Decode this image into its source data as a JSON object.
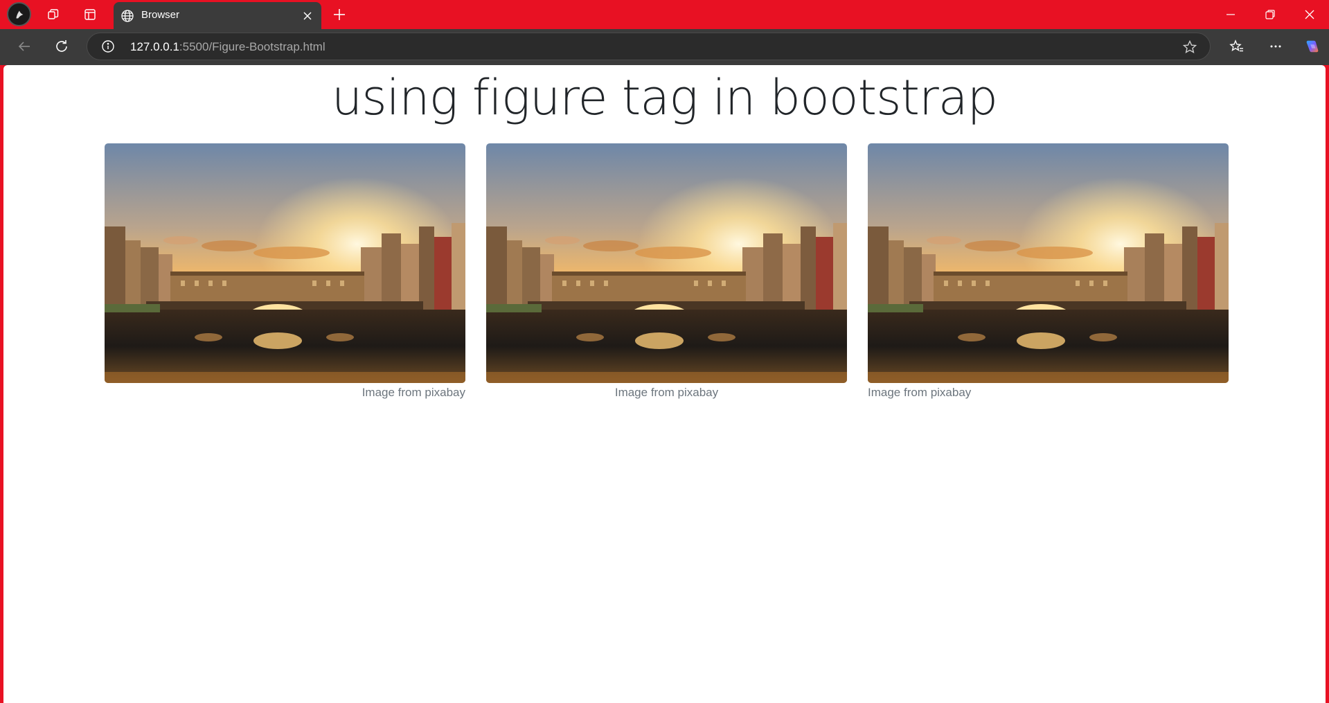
{
  "browser": {
    "tab_title": "Browser",
    "url_host": "127.0.0.1",
    "url_rest": ":5500/Figure-Bootstrap.html"
  },
  "page": {
    "heading": "using figure tag in bootstrap",
    "figures": [
      {
        "caption": "Image from pixabay",
        "caption_align": "right"
      },
      {
        "caption": "Image from pixabay",
        "caption_align": "center"
      },
      {
        "caption": "Image from pixabay",
        "caption_align": "left"
      }
    ]
  },
  "icons": {
    "profile": "profile-avatar-icon",
    "workspaces": "workspaces-icon",
    "tab_actions": "tab-actions-icon",
    "site": "globe-icon",
    "close_tab": "close-icon",
    "new_tab": "plus-icon",
    "back": "back-arrow-icon",
    "refresh": "refresh-icon",
    "site_info": "info-icon",
    "favorite": "star-icon",
    "favorites": "favorites-icon",
    "more": "more-icon",
    "copilot": "copilot-icon"
  },
  "colors": {
    "titlebar": "#e81123",
    "toolbar": "#3b3b3b",
    "caption": "#6c757d",
    "heading": "#212529"
  }
}
